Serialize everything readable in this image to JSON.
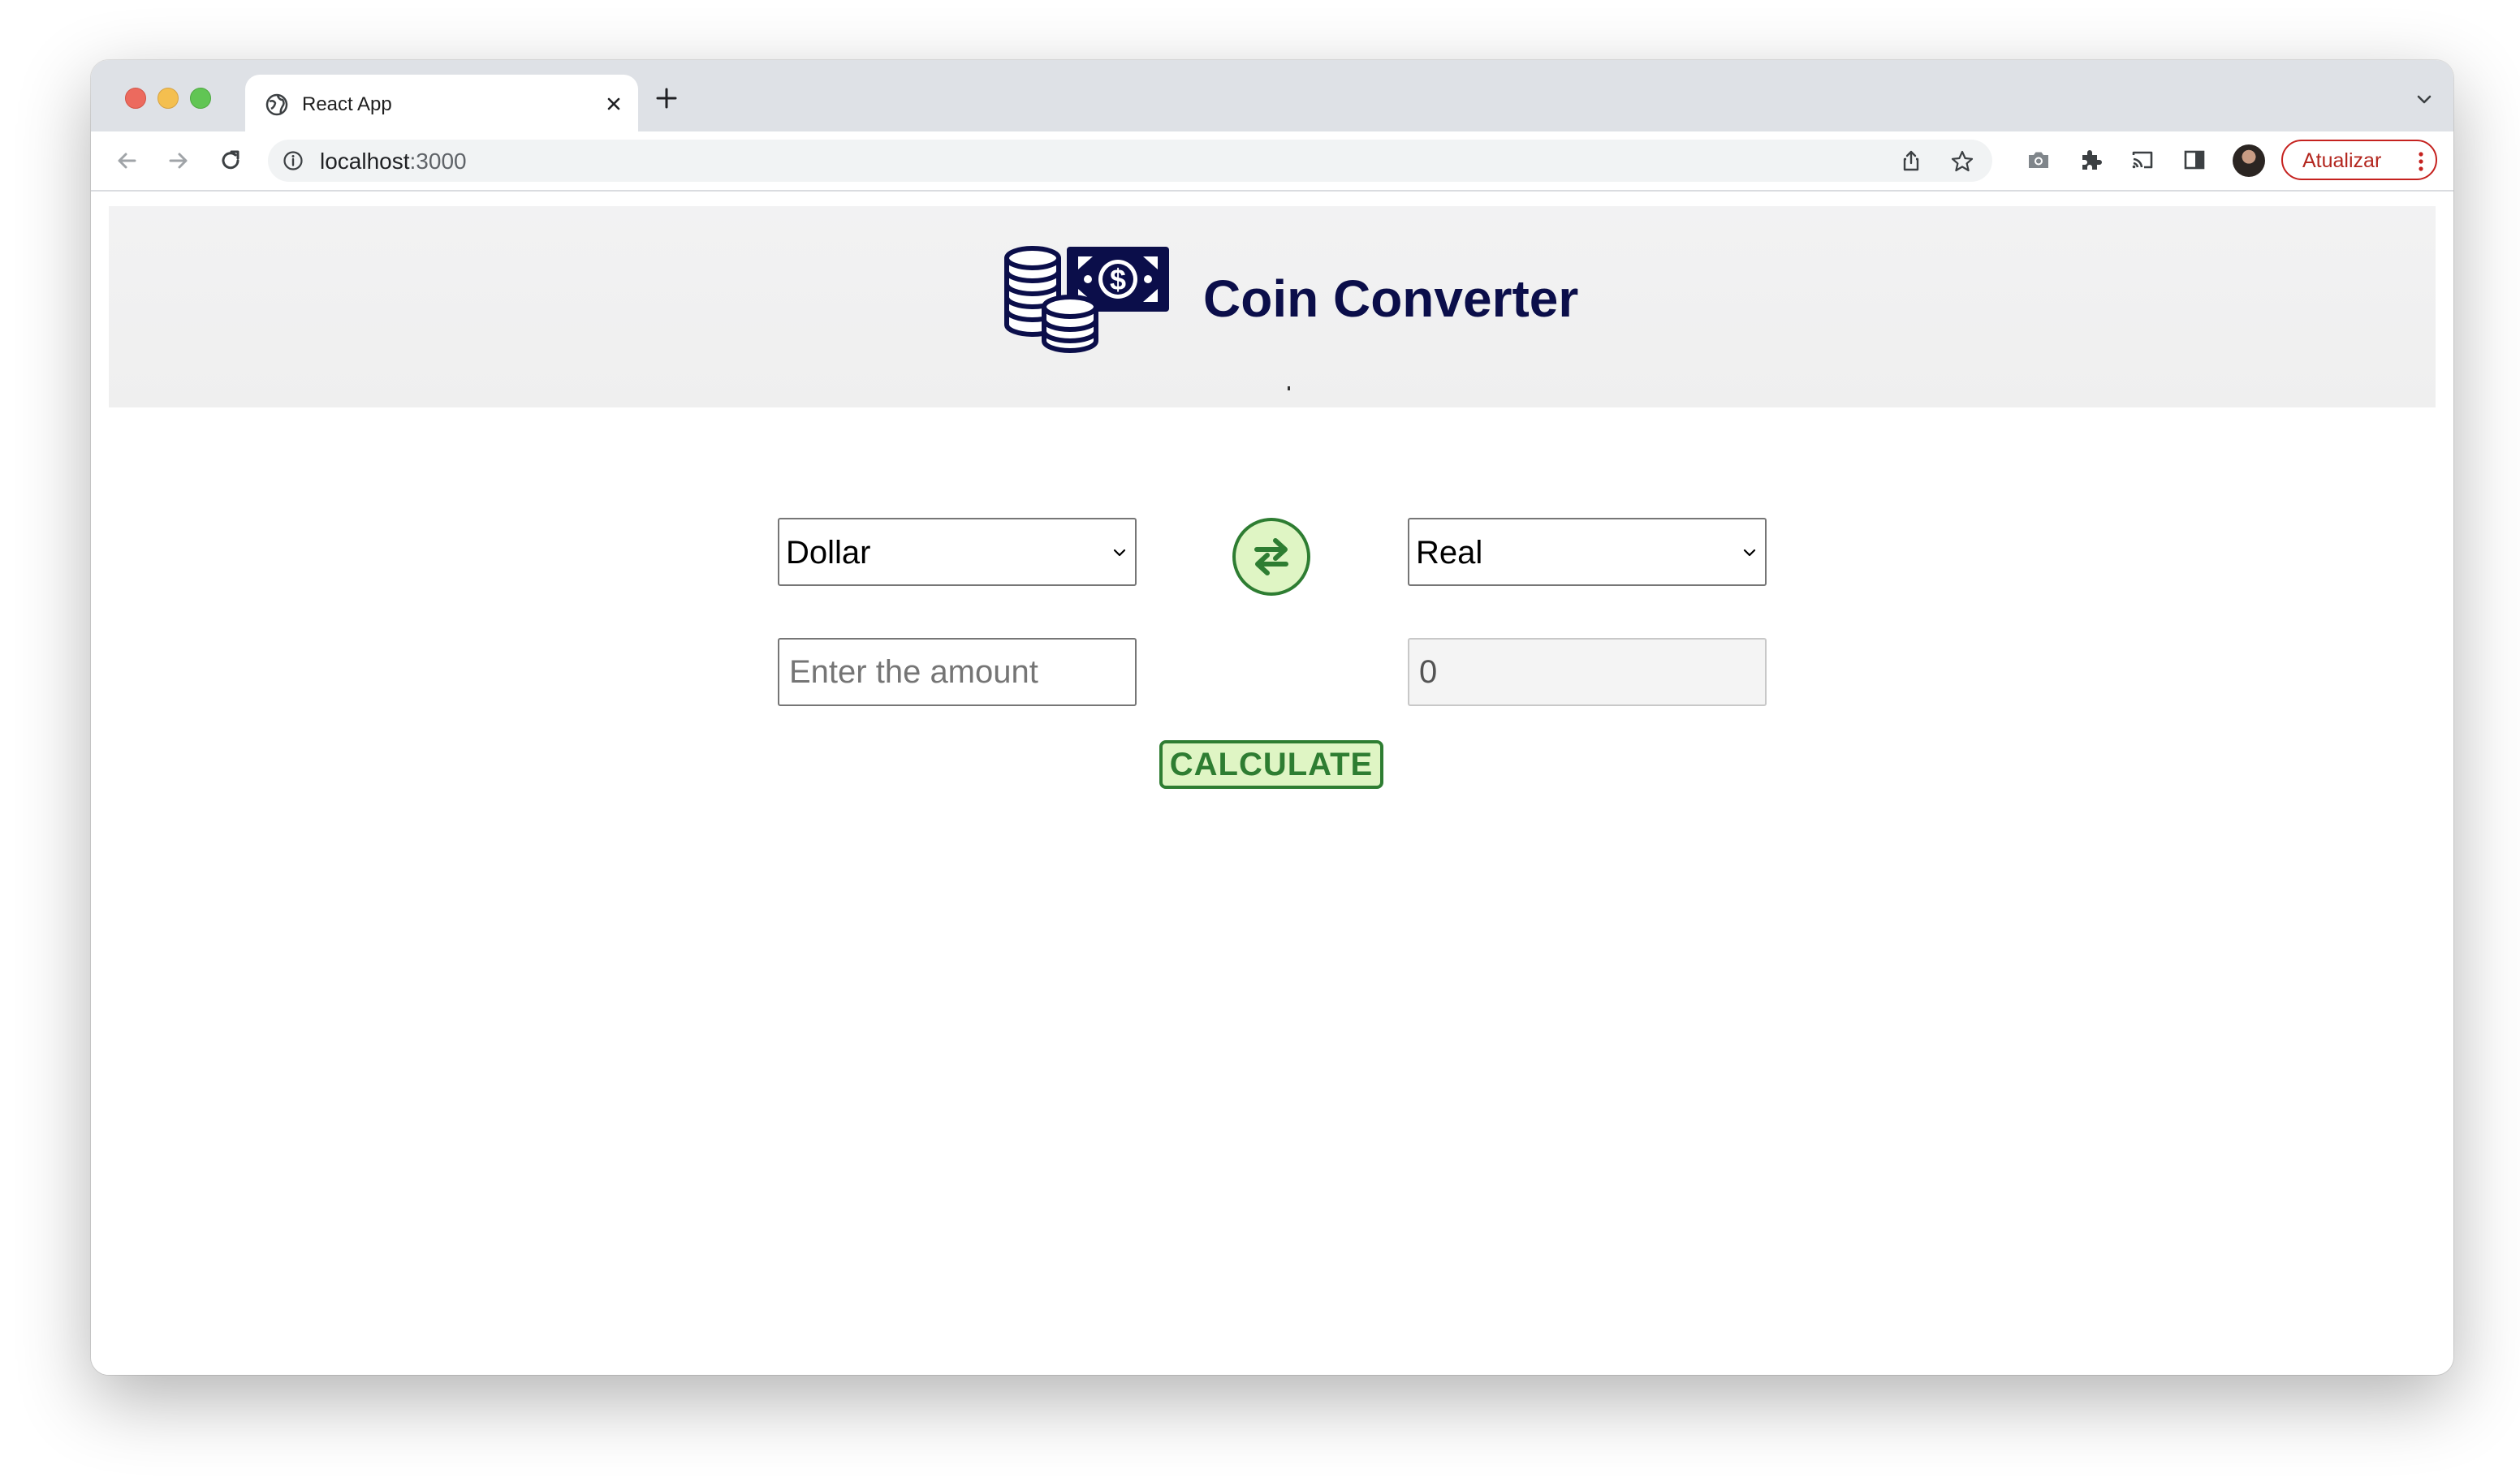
{
  "browser": {
    "tab_title": "React App",
    "url_host": "localhost",
    "url_port": ":3000",
    "update_label": "Atualizar"
  },
  "app": {
    "title": "Coin Converter",
    "logo_icon": "coins-and-banknote-icon",
    "from_currency": "Dollar",
    "to_currency": "Real",
    "amount_placeholder": "Enter the amount",
    "result_value": "0",
    "calculate_label": "CALCULATE",
    "swap_icon": "swap-arrows-icon"
  },
  "colors": {
    "title": "#0b0e4a",
    "accent_green": "#2e7d32",
    "button_fill": "#dff5c4",
    "update_red": "#c5221f"
  }
}
